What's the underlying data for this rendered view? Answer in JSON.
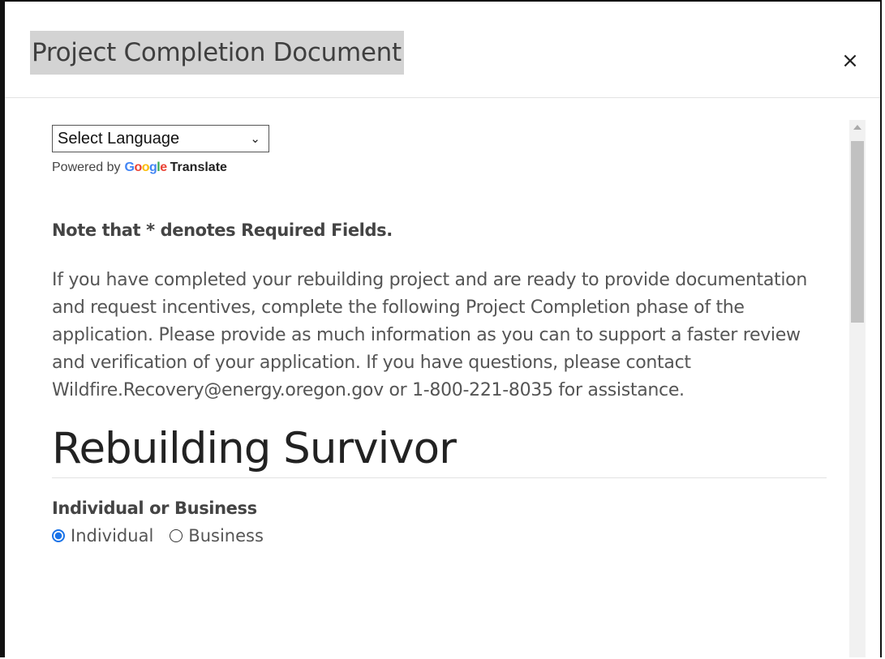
{
  "modal": {
    "title": "Project Completion Document",
    "close_label": "×"
  },
  "translate": {
    "select_label": "Select Language",
    "powered_by": "Powered by",
    "google": [
      "G",
      "o",
      "o",
      "g",
      "l",
      "e"
    ],
    "translate_label": "Translate"
  },
  "note": "Note that * denotes Required Fields.",
  "intro": "If you have completed your rebuilding project and are ready to provide documentation and request incentives, complete the following Project Completion phase of the application. Please provide as much information as you can to support a faster review and verification of your application. If you have questions, please contact Wildfire.Recovery@energy.oregon.gov or 1-800-221-8035 for assistance.",
  "section": {
    "title": "Rebuilding Survivor",
    "field_label": "Individual or Business",
    "options": [
      {
        "label": "Individual",
        "selected": true
      },
      {
        "label": "Business",
        "selected": false
      }
    ]
  },
  "colors": {
    "accent": "#1a73e8",
    "title_highlight": "#d3d3d3"
  }
}
